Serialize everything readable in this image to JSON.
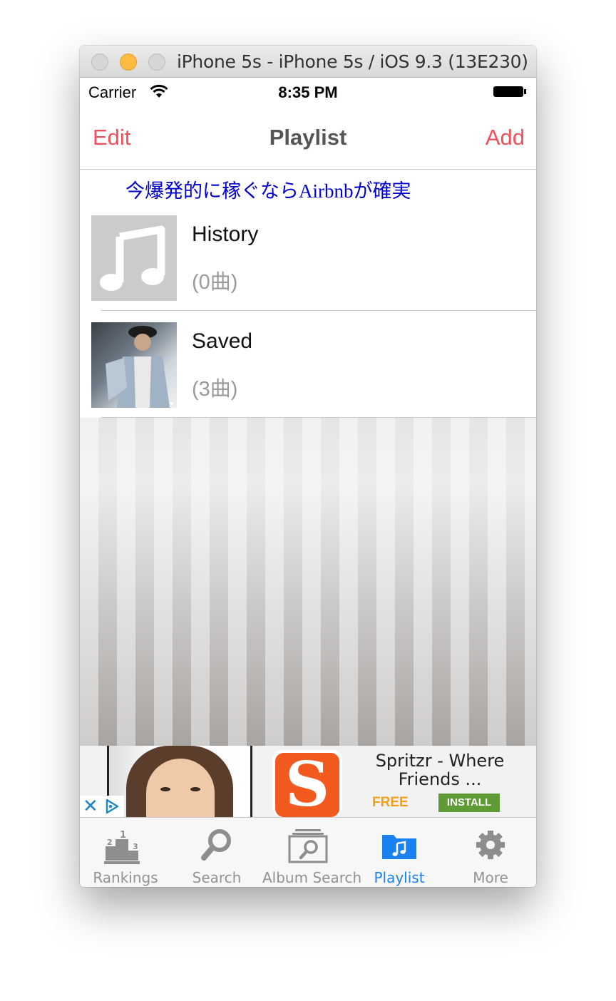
{
  "window": {
    "title": "iPhone 5s - iPhone 5s / iOS 9.3 (13E230)"
  },
  "status_bar": {
    "carrier": "Carrier",
    "time": "8:35 PM"
  },
  "nav": {
    "left_button": "Edit",
    "title": "Playlist",
    "right_button": "Add"
  },
  "promo_link": "今爆発的に稼ぐならAirbnbが確実",
  "playlists": [
    {
      "name": "History",
      "count": "(0曲)",
      "thumb_icon": "music-note-icon"
    },
    {
      "name": "Saved",
      "count": "(3曲)",
      "thumb_icon": "album-photo"
    }
  ],
  "ad": {
    "app_name": "Spritzr - Where Friends ...",
    "price": "FREE",
    "install_label": "INSTALL",
    "logo_letter": "S",
    "close_glyph": "✕"
  },
  "tabs": [
    {
      "label": "Rankings",
      "icon": "rankings-podium-icon",
      "active": false
    },
    {
      "label": "Search",
      "icon": "magnifier-icon",
      "active": false
    },
    {
      "label": "Album Search",
      "icon": "album-search-icon",
      "active": false
    },
    {
      "label": "Playlist",
      "icon": "playlist-folder-icon",
      "active": true
    },
    {
      "label": "More",
      "icon": "gear-icon",
      "active": false
    }
  ],
  "colors": {
    "accent_red": "#f0505a",
    "tab_active": "#1a82f0",
    "tab_inactive": "#929292",
    "promo_blue": "#0000cc"
  }
}
